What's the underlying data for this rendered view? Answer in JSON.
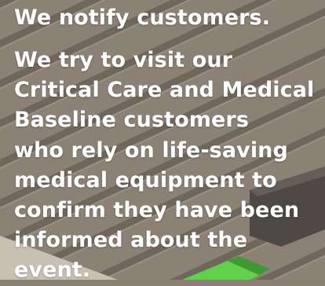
{
  "heading": "We notify customers.",
  "body_lines": [
    "We try to visit our",
    "Critical Care and Medical",
    "Baseline customers",
    "who rely on life-saving",
    "medical equipment to",
    "confirm they have been",
    "informed about the",
    "event."
  ],
  "colors": {
    "text": "#ffffff",
    "background": "#8a7f73",
    "accent_green": "#5fd24a"
  }
}
